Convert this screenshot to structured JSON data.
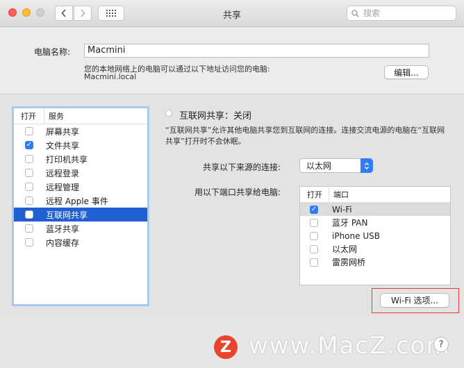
{
  "window": {
    "title": "共享"
  },
  "search": {
    "placeholder": "搜索"
  },
  "computer_name": {
    "label": "电脑名称:",
    "value": "Macmini",
    "address_note": "您的本地网络上的电脑可以通过以下地址访问您的电脑:",
    "address": "Macmini.local",
    "edit_label": "编辑..."
  },
  "services": {
    "header_on": "打开",
    "header_service": "服务",
    "items": [
      {
        "label": "屏幕共享",
        "checked": false,
        "selected": false
      },
      {
        "label": "文件共享",
        "checked": true,
        "selected": false
      },
      {
        "label": "打印机共享",
        "checked": false,
        "selected": false
      },
      {
        "label": "远程登录",
        "checked": false,
        "selected": false
      },
      {
        "label": "远程管理",
        "checked": false,
        "selected": false
      },
      {
        "label": "远程 Apple 事件",
        "checked": false,
        "selected": false
      },
      {
        "label": "互联网共享",
        "checked": false,
        "selected": true
      },
      {
        "label": "蓝牙共享",
        "checked": false,
        "selected": false
      },
      {
        "label": "内容缓存",
        "checked": false,
        "selected": false
      }
    ]
  },
  "internet_sharing": {
    "status": "互联网共享：关闭",
    "description": "“互联网共享”允许其他电脑共享您到互联网的连接。连接交流电源的电脑在“互联网共享”打开时不会休眠。",
    "source_label": "共享以下来源的连接:",
    "source_value": "以太网",
    "ports_label": "用以下端口共享给电脑:",
    "ports_header_on": "打开",
    "ports_header_port": "端口",
    "ports": [
      {
        "label": "Wi-Fi",
        "checked": true,
        "selected": true
      },
      {
        "label": "蓝牙 PAN",
        "checked": false,
        "selected": false
      },
      {
        "label": "iPhone USB",
        "checked": false,
        "selected": false
      },
      {
        "label": "以太网",
        "checked": false,
        "selected": false
      },
      {
        "label": "雷雳网桥",
        "checked": false,
        "selected": false
      }
    ],
    "wifi_options_label": "Wi-Fi 选项..."
  },
  "help": {
    "label": "?"
  },
  "watermark": {
    "logo": "Z",
    "text": "www.MacZ.com"
  },
  "colors": {
    "accent": "#2f7cf6",
    "selection": "#1f5fd1",
    "highlight_box": "#e23c3c"
  }
}
